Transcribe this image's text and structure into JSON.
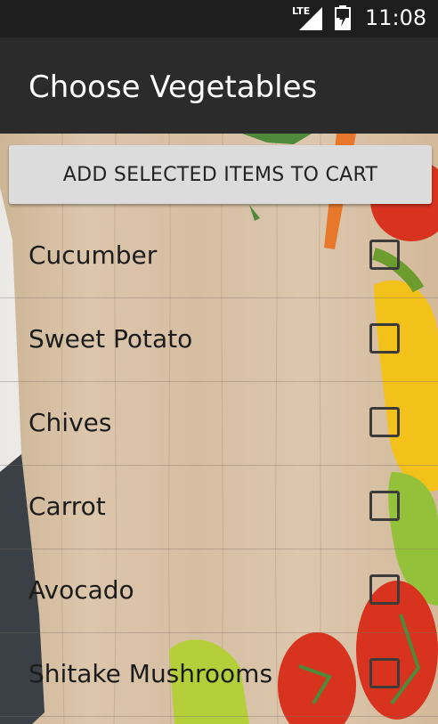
{
  "status": {
    "network": "LTE",
    "time": "11:08"
  },
  "appbar": {
    "title": "Choose Vegetables"
  },
  "actions": {
    "add_button": "ADD SELECTED ITEMS TO CART"
  },
  "items": [
    {
      "label": "Cucumber",
      "checked": false
    },
    {
      "label": "Sweet Potato",
      "checked": false
    },
    {
      "label": "Chives",
      "checked": false
    },
    {
      "label": "Carrot",
      "checked": false
    },
    {
      "label": "Avocado",
      "checked": false
    },
    {
      "label": "Shitake Mushrooms",
      "checked": false
    }
  ]
}
